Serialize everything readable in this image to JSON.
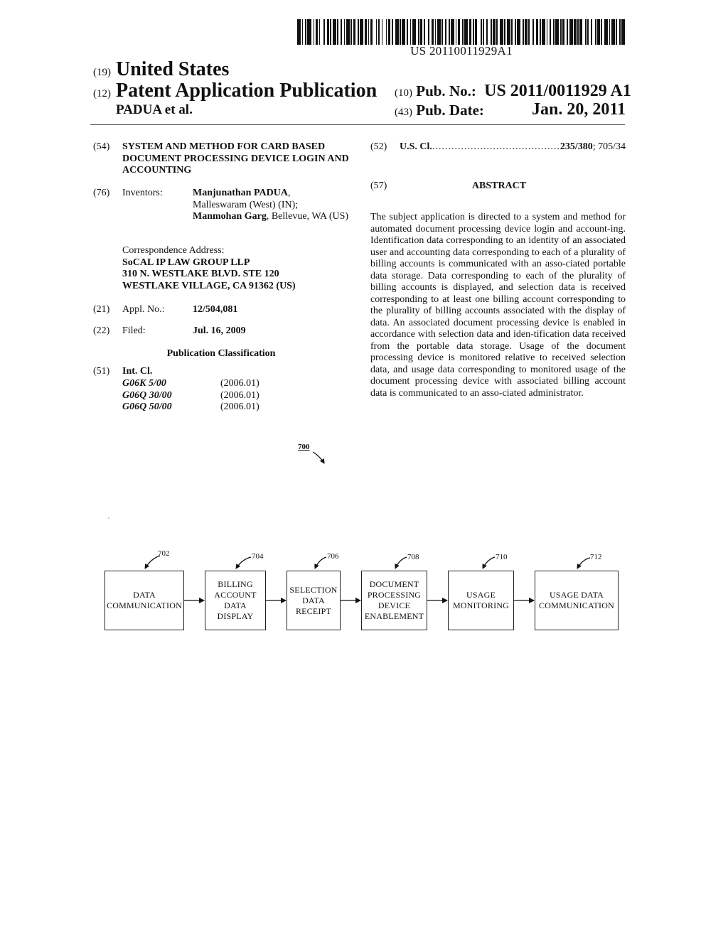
{
  "barcode": {
    "text": "US 20110011929A1"
  },
  "header": {
    "country_code": "(19)",
    "country": "United States",
    "type_code": "(12)",
    "type": "Patent Application Publication",
    "inventor_short": "PADUA et al.",
    "pub_no_code": "(10)",
    "pub_no_label": "Pub. No.:",
    "pub_no": "US 2011/0011929 A1",
    "pub_date_code": "(43)",
    "pub_date_label": "Pub. Date:",
    "pub_date": "Jan. 20, 2011"
  },
  "left": {
    "title": {
      "code": "(54)",
      "text": "SYSTEM AND METHOD FOR CARD BASED DOCUMENT PROCESSING DEVICE LOGIN AND ACCOUNTING"
    },
    "inventors": {
      "code": "(76)",
      "label": "Inventors:",
      "entries": [
        {
          "name": "Manjunathan PADUA",
          "location": "Malleswaram (West) (IN);"
        },
        {
          "name": "Manmohan Garg",
          "location": "Bellevue, WA (US)"
        }
      ]
    },
    "correspondence": {
      "label": "Correspondence Address:",
      "lines": [
        "SoCAL IP LAW GROUP LLP",
        "310 N. WESTLAKE BLVD. STE 120",
        "WESTLAKE VILLAGE, CA 91362 (US)"
      ]
    },
    "appl_no": {
      "code": "(21)",
      "label": "Appl. No.:",
      "value": "12/504,081"
    },
    "filed": {
      "code": "(22)",
      "label": "Filed:",
      "value": "Jul. 16, 2009"
    },
    "publication_classification": {
      "heading": "Publication Classification",
      "int_cl": {
        "code": "(51)",
        "label": "Int. Cl.",
        "entries": [
          {
            "class": "G06K 5/00",
            "version": "(2006.01)"
          },
          {
            "class": "G06Q 30/00",
            "version": "(2006.01)"
          },
          {
            "class": "G06Q 50/00",
            "version": "(2006.01)"
          }
        ]
      }
    }
  },
  "right": {
    "us_cl": {
      "code": "(52)",
      "label": "U.S. Cl.",
      "dots": "..............................................................",
      "primary": "235/380",
      "secondary": "; 705/34"
    },
    "abstract": {
      "code": "(57)",
      "heading": "ABSTRACT",
      "text": "The subject application is directed to a system and method for automated document processing device login and account-ing. Identification data corresponding to an identity of an associated user and accounting data corresponding to each of a plurality of billing accounts is communicated with an asso-ciated portable data storage. Data corresponding to each of the plurality of billing accounts is displayed, and selection data is received corresponding to at least one billing account corresponding to the plurality of billing accounts associated with the display of data. An associated document processing device is enabled in accordance with selection data and iden-tification data received from the portable data storage. Usage of the document processing device is monitored relative to received selection data, and usage data corresponding to monitored usage of the document processing device with associated billing account data is communicated to an asso-ciated administrator."
    }
  },
  "figure": {
    "ref": "700",
    "steps": [
      {
        "ref": "702",
        "lines": [
          "DATA",
          "COMMUNICATION"
        ]
      },
      {
        "ref": "704",
        "lines": [
          "BILLING",
          "ACCOUNT",
          "DATA",
          "DISPLAY"
        ]
      },
      {
        "ref": "706",
        "lines": [
          "SELECTION",
          "DATA",
          "RECEIPT"
        ]
      },
      {
        "ref": "708",
        "lines": [
          "DOCUMENT",
          "PROCESSING",
          "DEVICE",
          "ENABLEMENT"
        ]
      },
      {
        "ref": "710",
        "lines": [
          "USAGE",
          "MONITORING"
        ]
      },
      {
        "ref": "712",
        "lines": [
          "USAGE DATA",
          "COMMUNICATION"
        ]
      }
    ]
  }
}
